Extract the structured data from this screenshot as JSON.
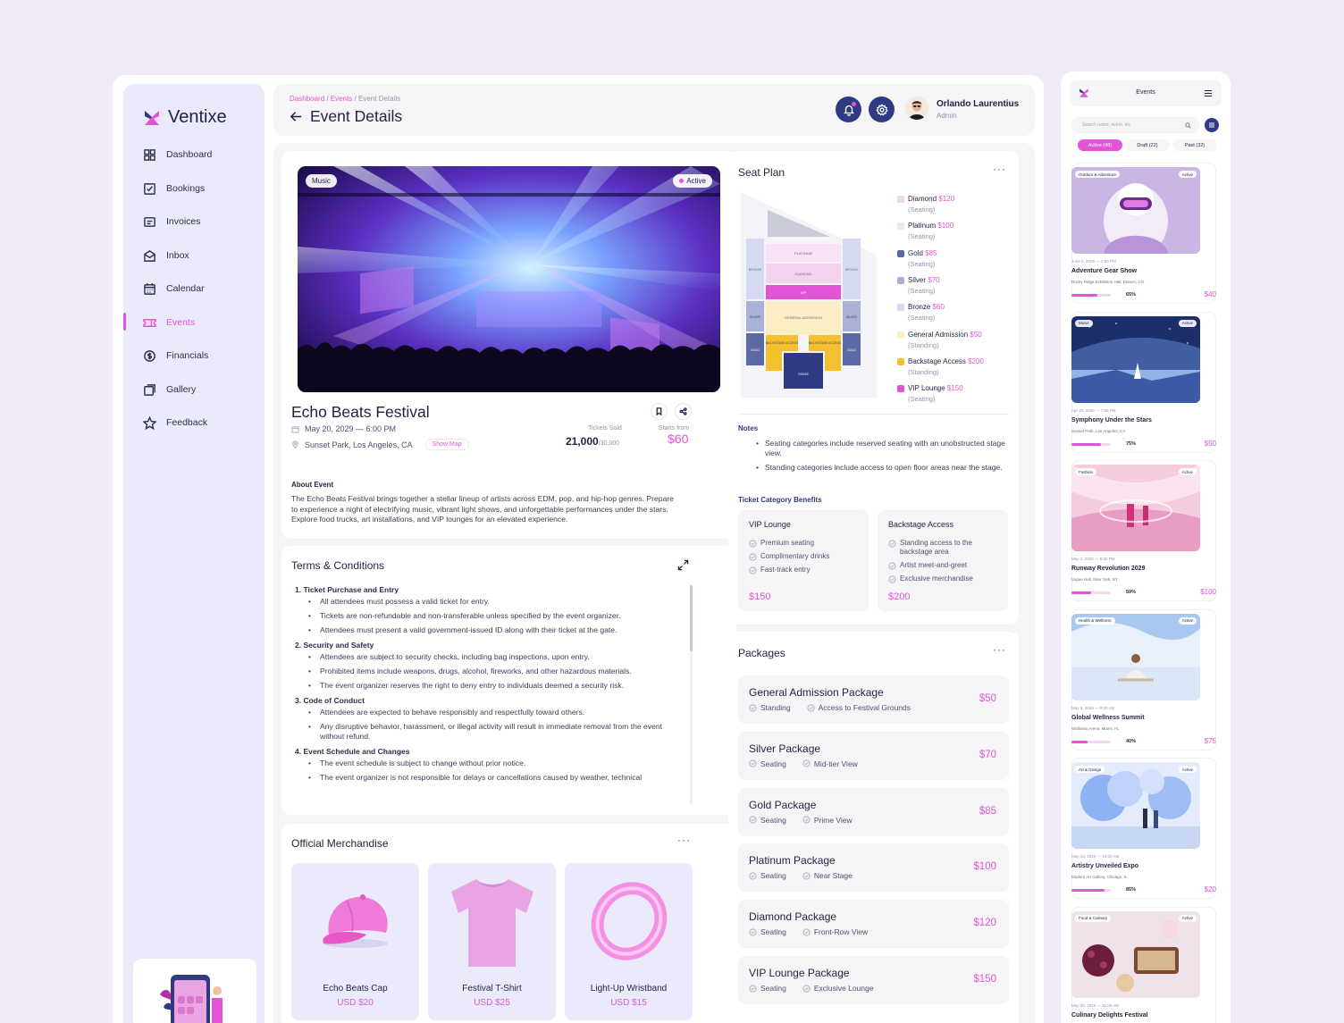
{
  "app": {
    "name": "Ventixe"
  },
  "nav": [
    {
      "label": "Dashboard",
      "icon": "dashboard-icon"
    },
    {
      "label": "Bookings",
      "icon": "bookings-icon"
    },
    {
      "label": "Invoices",
      "icon": "invoices-icon"
    },
    {
      "label": "Inbox",
      "icon": "inbox-icon"
    },
    {
      "label": "Calendar",
      "icon": "calendar-icon"
    },
    {
      "label": "Events",
      "icon": "events-icon",
      "active": true
    },
    {
      "label": "Financials",
      "icon": "financials-icon"
    },
    {
      "label": "Gallery",
      "icon": "gallery-icon"
    },
    {
      "label": "Feedback",
      "icon": "feedback-icon"
    }
  ],
  "header": {
    "breadcrumb": {
      "dashboard": "Dashboard",
      "sep": "/",
      "events": "Events",
      "current": "Event Details"
    },
    "title": "Event Details",
    "user": {
      "name": "Orlando Laurentius",
      "role": "Admin"
    }
  },
  "event": {
    "category": "Music",
    "status": "Active",
    "name": "Echo Beats Festival",
    "date": "May 20, 2029 — 6:00 PM",
    "location": "Sunset Park, Los Angeles, CA",
    "show_map": "Show Map",
    "tickets_sold_label": "Tickets Sold",
    "tickets_sold": "21,000",
    "tickets_total": "/30,000",
    "starts_from_label": "Starts from",
    "starts_from": "$60",
    "about_title": "About Event",
    "about_text": "The Echo Beats Festival brings together a stellar lineup of artists across EDM, pop, and hip-hop genres. Prepare to experience a night of electrifying music, vibrant light shows, and unforgettable performances under the stars. Explore food trucks, art installations, and VIP lounges for an elevated experience."
  },
  "terms": {
    "title": "Terms & Conditions",
    "sections": [
      {
        "heading": "1.   Ticket Purchase and Entry",
        "items": [
          "All attendees must possess a valid ticket for entry.",
          "Tickets are non-refundable and non-transferable unless specified by the event organizer.",
          "Attendees must present a valid government-issued ID along with their ticket at the gate."
        ]
      },
      {
        "heading": "2.   Security and Safety",
        "items": [
          "Attendees are subject to security checks, including bag inspections, upon entry.",
          "Prohibited items include weapons, drugs, alcohol, fireworks, and other hazardous materials.",
          "The event organizer reserves the right to deny entry to individuals deemed a security risk."
        ]
      },
      {
        "heading": "3.   Code of Conduct",
        "items": [
          "Attendees are expected to behave responsibly and respectfully toward others.",
          "Any disruptive behavior, harassment, or illegal activity will result in immediate removal from the event without refund."
        ]
      },
      {
        "heading": "4.   Event Schedule and Changes",
        "items": [
          "The event schedule is subject to change without prior notice.",
          "The event organizer is not responsible for delays or cancellations caused by weather, technical"
        ]
      }
    ]
  },
  "merch": {
    "title": "Official Merchandise",
    "items": [
      {
        "name": "Echo Beats Cap",
        "price": "USD $20"
      },
      {
        "name": "Festival T-Shirt",
        "price": "USD $25"
      },
      {
        "name": "Light-Up Wristband",
        "price": "USD $15"
      }
    ]
  },
  "seat_plan": {
    "title": "Seat Plan",
    "map_labels": {
      "platinum": "PLATINUM",
      "diamond": "DIAMOND",
      "vip": "VIP",
      "general": "GENERAL ADMISSION",
      "bronze": "BRONZE",
      "silver": "SILVER",
      "gold": "GOLD",
      "backstage": "BACKSTAGE ACCESS",
      "stage": "STAGE"
    },
    "legend": [
      {
        "name": "Diamond",
        "price": "$120",
        "type": "(Seating)",
        "color": "#f6d2f1"
      },
      {
        "name": "Platinum",
        "price": "$100",
        "type": "(Seating)",
        "color": "#f7e3f5"
      },
      {
        "name": "Gold",
        "price": "$85",
        "type": "(Seating)",
        "color": "#5b6aa6"
      },
      {
        "name": "Silver",
        "price": "$70",
        "type": "(Seating)",
        "color": "#a9b1d6"
      },
      {
        "name": "Bronze",
        "price": "$60",
        "type": "(Seating)",
        "color": "#d5d9f1"
      },
      {
        "name": "General Admission",
        "price": "$50",
        "type": "(Standing)",
        "color": "#fbeec4"
      },
      {
        "name": "Backstage Access",
        "price": "$200",
        "type": "(Standing)",
        "color": "#f4c02d"
      },
      {
        "name": "VIP Lounge",
        "price": "$150",
        "type": "(Seating)",
        "color": "#e255d6"
      }
    ],
    "notes_title": "Notes",
    "notes": [
      "Seating categories include reserved seating with an unobstructed stage view.",
      "Standing categories include access to open floor areas near the stage."
    ],
    "benefits_title": "Ticket Category Benefits",
    "benefits": [
      {
        "name": "VIP Lounge",
        "items": [
          "Premium seating",
          "Complimentary drinks",
          "Fast-track entry"
        ],
        "price": "$150"
      },
      {
        "name": "Backstage Access",
        "items": [
          "Standing access to the backstage area",
          "Artist meet-and-greet",
          "Exclusive merchandise"
        ],
        "price": "$200"
      }
    ]
  },
  "packages": {
    "title": "Packages",
    "items": [
      {
        "name": "General Admission Package",
        "tags": [
          "Standing",
          "Access to Festival Grounds"
        ],
        "price": "$50"
      },
      {
        "name": "Silver Package",
        "tags": [
          "Seating",
          "Mid-tier View"
        ],
        "price": "$70"
      },
      {
        "name": "Gold Package",
        "tags": [
          "Seating",
          "Prime View"
        ],
        "price": "$85"
      },
      {
        "name": "Platinum Package",
        "tags": [
          "Seating",
          "Near Stage"
        ],
        "price": "$100"
      },
      {
        "name": "Diamond Package",
        "tags": [
          "Seating",
          "Front-Row View"
        ],
        "price": "$120"
      },
      {
        "name": "VIP Lounge Package",
        "tags": [
          "Seating",
          "Exclusive Lounge"
        ],
        "price": "$150"
      }
    ]
  },
  "mobile": {
    "title": "Events",
    "search_placeholder": "Search name, event, etc",
    "tabs": [
      {
        "label": "Active (48)"
      },
      {
        "label": "Draft (22)"
      },
      {
        "label": "Past (32)"
      }
    ],
    "events": [
      {
        "category": "Outdoor & Adventure",
        "status": "Active",
        "date": "June 5, 2029 — 2:00 PM",
        "name": "Adventure Gear Show",
        "location": "Rocky Ridge Exhibition Hall, Denver, CO",
        "progress": 65,
        "progress_label": "65%",
        "price": "$40"
      },
      {
        "category": "Music",
        "status": "Active",
        "date": "Apr 20, 2029 — 7:00 PM",
        "name": "Symphony Under the Stars",
        "location": "Sunset Park, Los Angeles, CA",
        "progress": 75,
        "progress_label": "75%",
        "price": "$50"
      },
      {
        "category": "Fashion",
        "status": "Active",
        "date": "May 1, 2029 — 6:00 PM",
        "name": "Runway Revolution 2029",
        "location": "Vogue Hall, New York, NY",
        "progress": 50,
        "progress_label": "50%",
        "price": "$100"
      },
      {
        "category": "Health & Wellness",
        "status": "Active",
        "date": "May 5, 2029 — 9:00 AM",
        "name": "Global Wellness Summit",
        "location": "Wellness Arena, Miami, FL",
        "progress": 40,
        "progress_label": "40%",
        "price": "$75"
      },
      {
        "category": "Art & Design",
        "status": "Active",
        "date": "May 15, 2029 — 10:00 AM",
        "name": "Artistry Unveiled Expo",
        "location": "Modern Art Gallery, Chicago, IL",
        "progress": 85,
        "progress_label": "85%",
        "price": "$20"
      },
      {
        "category": "Food & Culinary",
        "status": "Active",
        "date": "May 25, 2029 — 11:00 AM",
        "name": "Culinary Delights Festival",
        "location": "",
        "progress": 0,
        "progress_label": "",
        "price": ""
      }
    ]
  },
  "colors": {
    "accent": "#e255d6",
    "navy": "#2f3a83",
    "sidebar_bg": "#ebeafb",
    "page_bg": "#f1e9f6"
  }
}
